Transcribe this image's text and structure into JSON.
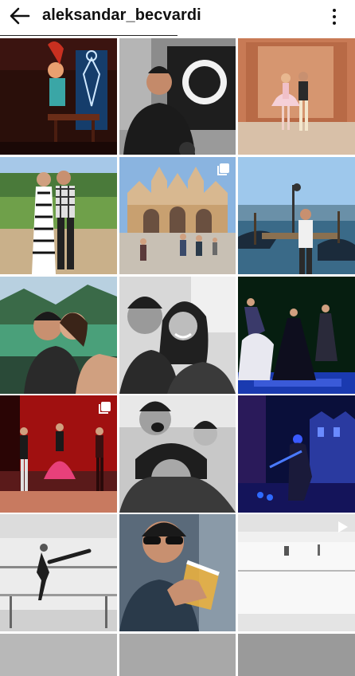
{
  "header": {
    "title": "aleksandar_becvardi",
    "back_icon": "back-arrow-icon",
    "menu_icon": "more-vertical-icon"
  },
  "grid": {
    "posts": [
      {
        "subject": "stage performance with skeleton prop",
        "badge": null
      },
      {
        "subject": "man by Moto Platz Belgrade sign",
        "badge": null
      },
      {
        "subject": "ballet couple on palace stage",
        "badge": null
      },
      {
        "subject": "couple in park",
        "badge": null
      },
      {
        "subject": "St Mark's Basilica Venice",
        "badge": "multiple-photos-icon"
      },
      {
        "subject": "man at Venice gondola pier",
        "badge": null
      },
      {
        "subject": "couple kissing by lake",
        "badge": null
      },
      {
        "subject": "black and white selfie couple",
        "badge": null
      },
      {
        "subject": "dancers on blue lit stage",
        "badge": null
      },
      {
        "subject": "dancers on red stage",
        "badge": "multiple-photos-icon"
      },
      {
        "subject": "black and white group selfie",
        "badge": null
      },
      {
        "subject": "night street performance blue light",
        "badge": null
      },
      {
        "subject": "ballet barre stretch black and white",
        "badge": null
      },
      {
        "subject": "man drinking beer",
        "badge": null
      },
      {
        "subject": "white dance studio",
        "badge": "video-icon"
      }
    ]
  }
}
